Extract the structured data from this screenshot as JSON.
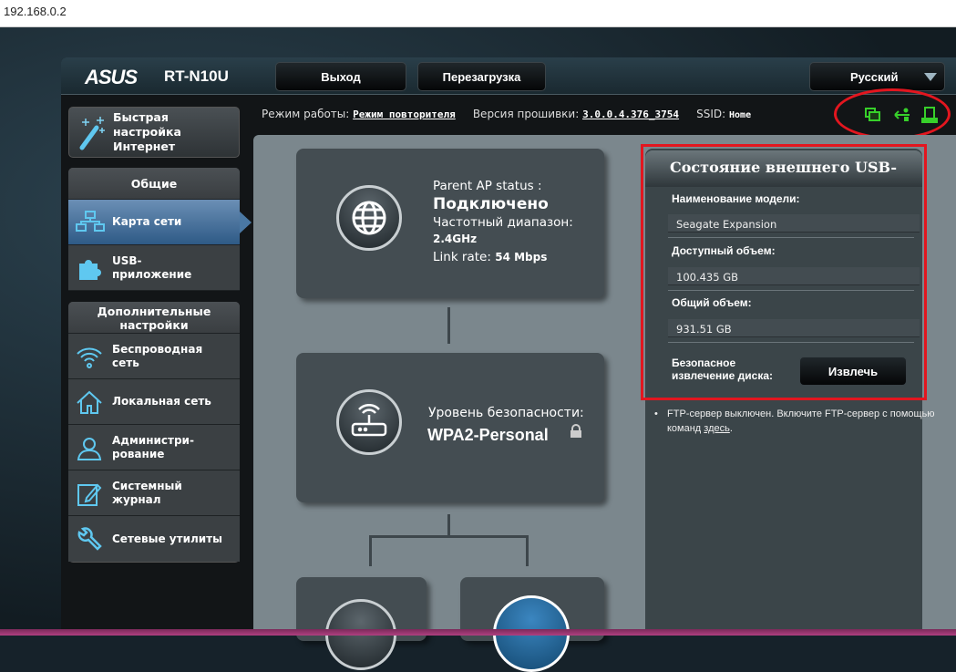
{
  "address_bar": {
    "url": "192.168.0.2"
  },
  "header": {
    "brand": "ASUS",
    "model": "RT-N10U",
    "logout": "Выход",
    "reboot": "Перезагрузка",
    "language": "Русский"
  },
  "info": {
    "mode_label": "Режим работы:",
    "mode_value": "Режим повторителя",
    "fw_label": "Версия прошивки:",
    "fw_value": "3.0.0.4.376_3754",
    "ssid_label": "SSID:",
    "ssid_value": "Home"
  },
  "status_icons": [
    "network-clients-icon",
    "usb-icon",
    "printer-icon"
  ],
  "colors": {
    "accent": "#4fb4e6",
    "status_green": "#37d02a",
    "highlight": "#e3161f"
  },
  "sidebar": {
    "quick": "Быстрая настройка Интернет",
    "general_header": "Общие",
    "general": [
      {
        "label": "Карта сети",
        "icon": "network-map-icon"
      },
      {
        "label": "USB-приложение",
        "icon": "puzzle-icon"
      }
    ],
    "advanced_header": "Дополнительные настройки",
    "advanced": [
      {
        "label": "Беспроводная сеть",
        "icon": "wifi-icon"
      },
      {
        "label": "Локальная сеть",
        "icon": "home-icon"
      },
      {
        "label": "Администри-рование",
        "icon": "user-icon"
      },
      {
        "label": "Системный журнал",
        "icon": "log-icon"
      },
      {
        "label": "Сетевые утилиты",
        "icon": "wrench-icon"
      }
    ]
  },
  "map": {
    "internet": {
      "title": "Parent AP status :",
      "status": "Подключено",
      "band_label": "Частотный диапазон:",
      "band": "2.4GHz",
      "rate_label": "Link rate:",
      "rate": "54 Mbps"
    },
    "router": {
      "security_label": "Уровень безопасности:",
      "security": "WPA2-Personal"
    }
  },
  "usb_panel": {
    "title": "Состояние внешнего USB-",
    "model_label": "Наименование модели:",
    "model": "Seagate Expansion",
    "free_label": "Доступный объем:",
    "free": "100.435 GB",
    "total_label": "Общий объем:",
    "total": "931.51 GB",
    "eject_label": "Безопасное извлечение диска:",
    "eject_button": "Извлечь",
    "ftp_note": "FTP-сервер выключен. Включите FTP-сервер с помощью команд ",
    "ftp_link": "здесь",
    "ftp_end": "."
  }
}
